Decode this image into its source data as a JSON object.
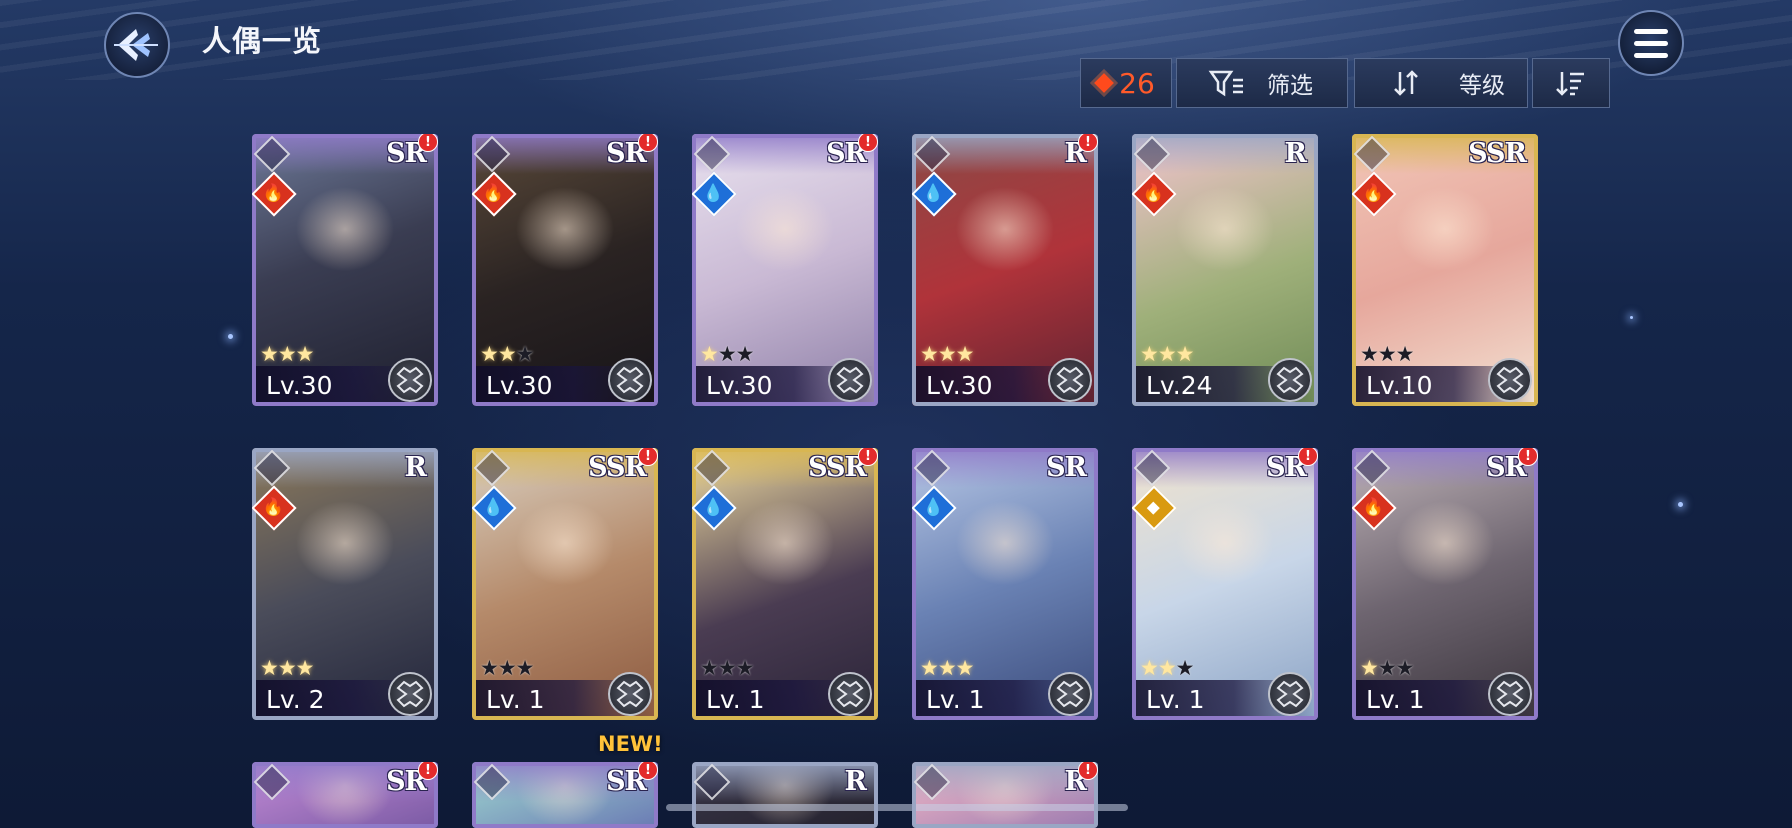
{
  "header": {
    "title": "人偶一览",
    "back_icon": "back-arrow-icon",
    "menu_icon": "hamburger-menu-icon"
  },
  "toolbar": {
    "count": "26",
    "count_icon": "red-gem-icon",
    "filter_label": "筛选",
    "sort_label": "等级",
    "order_icon": "sort-descending-icon"
  },
  "colors": {
    "sr_frame": "#8f7ac8",
    "ssr_frame": "#d8b652",
    "r_frame": "#9aa6c4",
    "accent": "#ff5a2a"
  },
  "cards": [
    {
      "rarity": "SR",
      "level": "Lv.30",
      "stars": 3,
      "element": "fire",
      "alert": "!",
      "new": ""
    },
    {
      "rarity": "SR",
      "level": "Lv.30",
      "stars": 2,
      "element": "fire",
      "alert": "!",
      "new": ""
    },
    {
      "rarity": "SR",
      "level": "Lv.30",
      "stars": 1,
      "element": "water",
      "alert": "!",
      "new": ""
    },
    {
      "rarity": "R",
      "level": "Lv.30",
      "stars": 3,
      "element": "water",
      "alert": "!",
      "new": ""
    },
    {
      "rarity": "R",
      "level": "Lv.24",
      "stars": 3,
      "element": "fire",
      "alert": "",
      "new": ""
    },
    {
      "rarity": "SSR",
      "level": "Lv.10",
      "stars": 0,
      "element": "fire",
      "alert": "",
      "new": ""
    },
    {
      "rarity": "R",
      "level": "Lv. 2",
      "stars": 3,
      "element": "fire",
      "alert": "",
      "new": ""
    },
    {
      "rarity": "SSR",
      "level": "Lv. 1",
      "stars": 0,
      "element": "water",
      "alert": "!",
      "new": ""
    },
    {
      "rarity": "SSR",
      "level": "Lv. 1",
      "stars": 0,
      "element": "water",
      "alert": "!",
      "new": ""
    },
    {
      "rarity": "SR",
      "level": "Lv. 1",
      "stars": 3,
      "element": "water",
      "alert": "",
      "new": ""
    },
    {
      "rarity": "SR",
      "level": "Lv. 1",
      "stars": 2,
      "element": "light",
      "alert": "!",
      "new": ""
    },
    {
      "rarity": "SR",
      "level": "Lv. 1",
      "stars": 1,
      "element": "fire",
      "alert": "!",
      "new": ""
    },
    {
      "rarity": "SR",
      "level": "",
      "stars": 0,
      "element": "",
      "alert": "!",
      "new": ""
    },
    {
      "rarity": "SR",
      "level": "",
      "stars": 0,
      "element": "",
      "alert": "!",
      "new": "NEW!"
    },
    {
      "rarity": "R",
      "level": "",
      "stars": 0,
      "element": "",
      "alert": "",
      "new": ""
    },
    {
      "rarity": "R",
      "level": "",
      "stars": 0,
      "element": "",
      "alert": "!",
      "new": ""
    }
  ]
}
